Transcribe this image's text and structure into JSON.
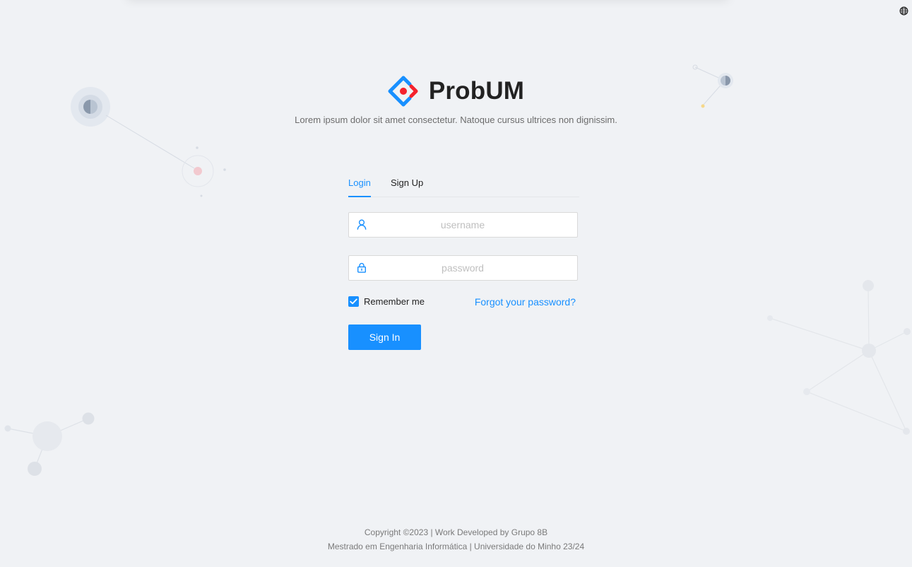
{
  "app": {
    "name": "ProbUM",
    "description": "Lorem ipsum dolor sit amet consectetur. Natoque cursus ultrices non dignissim."
  },
  "tabs": [
    {
      "label": "Login",
      "active": true
    },
    {
      "label": "Sign Up",
      "active": false
    }
  ],
  "form": {
    "username": {
      "value": "",
      "placeholder": "username",
      "icon": "user-icon"
    },
    "password": {
      "value": "",
      "placeholder": "password",
      "icon": "lock-icon"
    },
    "remember_label": "Remember me",
    "remember_checked": true,
    "forgot_label": "Forgot your password?",
    "submit_label": "Sign In"
  },
  "footer": {
    "line1": "Copyright ©2023 | Work Developed by Grupo 8B",
    "line2": "Mestrado em Engenharia Informática | Universidade do Minho 23/24"
  },
  "header_icons": {
    "language": "globe-icon"
  },
  "colors": {
    "primary": "#1890ff",
    "logo_accent": "#f5222d",
    "background": "#f0f2f5"
  }
}
